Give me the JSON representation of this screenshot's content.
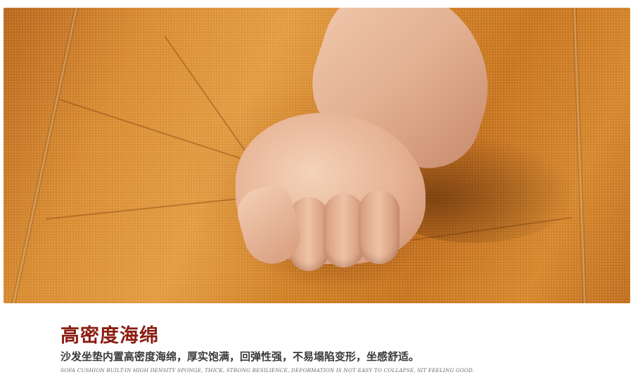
{
  "photo": {
    "description_icon": "leather-cushion-fist-photo"
  },
  "caption": {
    "title": "高密度海绵",
    "subtitle": "沙发坐垫内置高密度海绵，厚实饱满，回弹性强，不易塌陷变形，坐感舒适。",
    "english": "SOFA CUSHION BUILT-IN HIGH DENSITY SPONGE, THICK, STRONG RESILIENCE, DEFORMATION IS NOT EASY TO COLLAPSE, SIT FEELING GOOD."
  },
  "colors": {
    "title": "#8b1d12",
    "leather": "#d88b31"
  }
}
